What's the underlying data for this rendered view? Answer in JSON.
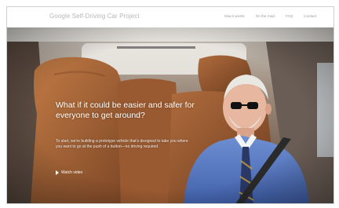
{
  "header": {
    "brand": "Google Self-Driving Car Project",
    "nav": [
      "How it works",
      "On the road",
      "FAQ",
      "Contact"
    ]
  },
  "hero": {
    "headline": "What if it could be easier and safer for everyone to get around?",
    "body": "To start, we're building a prototype vehicle that's designed to take you where you want to go at the push of a button—no driving required.",
    "watch_label": "Watch video"
  },
  "colors": {
    "brand_text": "#b7b7b7",
    "seat_leather": "#a8673b",
    "shirt": "#5b7bbf",
    "headline_text": "#ffffff"
  },
  "icons": [
    "play-icon"
  ]
}
